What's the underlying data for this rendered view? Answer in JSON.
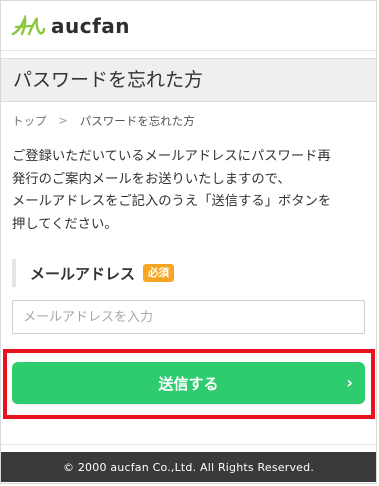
{
  "header": {
    "logo_text": "aucfan",
    "logo_icon": "aucfan-logo-mark",
    "brand_color": "#8dc63f"
  },
  "page": {
    "title": "パスワードを忘れた方"
  },
  "breadcrumb": {
    "items": [
      "トップ",
      "パスワードを忘れた方"
    ],
    "separator": ">"
  },
  "intro": {
    "lines": [
      "ご登録いただいているメールアドレスにパスワード再",
      "発行のご案内メールをお送りいたしますので、",
      "メールアドレスをご記入のうえ「送信する」ボタンを",
      "押してください。"
    ]
  },
  "form": {
    "email_label": "メールアドレス",
    "required_badge": "必須",
    "required_color": "#f5a623",
    "email_value": "",
    "email_placeholder": "メールアドレスを入力",
    "submit_label": "送信する",
    "submit_color": "#2ecc6e",
    "submit_icon": "chevron-right-icon",
    "highlight_color": "#e8111d"
  },
  "footer": {
    "copyright": "© 2000 aucfan Co.,Ltd. All Rights Reserved."
  }
}
